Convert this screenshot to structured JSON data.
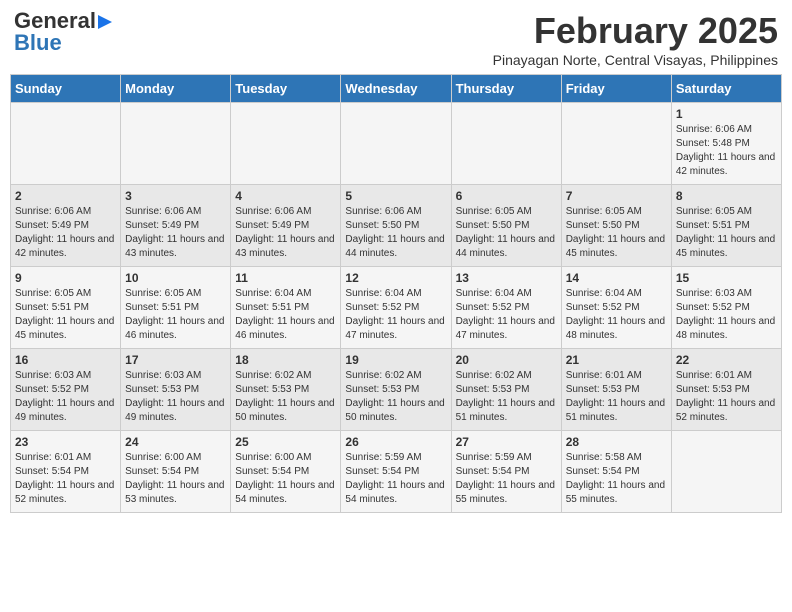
{
  "header": {
    "logo_line1": "General",
    "logo_line2": "Blue",
    "month": "February 2025",
    "location": "Pinayagan Norte, Central Visayas, Philippines"
  },
  "days_of_week": [
    "Sunday",
    "Monday",
    "Tuesday",
    "Wednesday",
    "Thursday",
    "Friday",
    "Saturday"
  ],
  "weeks": [
    [
      {
        "day": "",
        "info": ""
      },
      {
        "day": "",
        "info": ""
      },
      {
        "day": "",
        "info": ""
      },
      {
        "day": "",
        "info": ""
      },
      {
        "day": "",
        "info": ""
      },
      {
        "day": "",
        "info": ""
      },
      {
        "day": "1",
        "info": "Sunrise: 6:06 AM\nSunset: 5:48 PM\nDaylight: 11 hours and 42 minutes."
      }
    ],
    [
      {
        "day": "2",
        "info": "Sunrise: 6:06 AM\nSunset: 5:49 PM\nDaylight: 11 hours and 42 minutes."
      },
      {
        "day": "3",
        "info": "Sunrise: 6:06 AM\nSunset: 5:49 PM\nDaylight: 11 hours and 43 minutes."
      },
      {
        "day": "4",
        "info": "Sunrise: 6:06 AM\nSunset: 5:49 PM\nDaylight: 11 hours and 43 minutes."
      },
      {
        "day": "5",
        "info": "Sunrise: 6:06 AM\nSunset: 5:50 PM\nDaylight: 11 hours and 44 minutes."
      },
      {
        "day": "6",
        "info": "Sunrise: 6:05 AM\nSunset: 5:50 PM\nDaylight: 11 hours and 44 minutes."
      },
      {
        "day": "7",
        "info": "Sunrise: 6:05 AM\nSunset: 5:50 PM\nDaylight: 11 hours and 45 minutes."
      },
      {
        "day": "8",
        "info": "Sunrise: 6:05 AM\nSunset: 5:51 PM\nDaylight: 11 hours and 45 minutes."
      }
    ],
    [
      {
        "day": "9",
        "info": "Sunrise: 6:05 AM\nSunset: 5:51 PM\nDaylight: 11 hours and 45 minutes."
      },
      {
        "day": "10",
        "info": "Sunrise: 6:05 AM\nSunset: 5:51 PM\nDaylight: 11 hours and 46 minutes."
      },
      {
        "day": "11",
        "info": "Sunrise: 6:04 AM\nSunset: 5:51 PM\nDaylight: 11 hours and 46 minutes."
      },
      {
        "day": "12",
        "info": "Sunrise: 6:04 AM\nSunset: 5:52 PM\nDaylight: 11 hours and 47 minutes."
      },
      {
        "day": "13",
        "info": "Sunrise: 6:04 AM\nSunset: 5:52 PM\nDaylight: 11 hours and 47 minutes."
      },
      {
        "day": "14",
        "info": "Sunrise: 6:04 AM\nSunset: 5:52 PM\nDaylight: 11 hours and 48 minutes."
      },
      {
        "day": "15",
        "info": "Sunrise: 6:03 AM\nSunset: 5:52 PM\nDaylight: 11 hours and 48 minutes."
      }
    ],
    [
      {
        "day": "16",
        "info": "Sunrise: 6:03 AM\nSunset: 5:52 PM\nDaylight: 11 hours and 49 minutes."
      },
      {
        "day": "17",
        "info": "Sunrise: 6:03 AM\nSunset: 5:53 PM\nDaylight: 11 hours and 49 minutes."
      },
      {
        "day": "18",
        "info": "Sunrise: 6:02 AM\nSunset: 5:53 PM\nDaylight: 11 hours and 50 minutes."
      },
      {
        "day": "19",
        "info": "Sunrise: 6:02 AM\nSunset: 5:53 PM\nDaylight: 11 hours and 50 minutes."
      },
      {
        "day": "20",
        "info": "Sunrise: 6:02 AM\nSunset: 5:53 PM\nDaylight: 11 hours and 51 minutes."
      },
      {
        "day": "21",
        "info": "Sunrise: 6:01 AM\nSunset: 5:53 PM\nDaylight: 11 hours and 51 minutes."
      },
      {
        "day": "22",
        "info": "Sunrise: 6:01 AM\nSunset: 5:53 PM\nDaylight: 11 hours and 52 minutes."
      }
    ],
    [
      {
        "day": "23",
        "info": "Sunrise: 6:01 AM\nSunset: 5:54 PM\nDaylight: 11 hours and 52 minutes."
      },
      {
        "day": "24",
        "info": "Sunrise: 6:00 AM\nSunset: 5:54 PM\nDaylight: 11 hours and 53 minutes."
      },
      {
        "day": "25",
        "info": "Sunrise: 6:00 AM\nSunset: 5:54 PM\nDaylight: 11 hours and 54 minutes."
      },
      {
        "day": "26",
        "info": "Sunrise: 5:59 AM\nSunset: 5:54 PM\nDaylight: 11 hours and 54 minutes."
      },
      {
        "day": "27",
        "info": "Sunrise: 5:59 AM\nSunset: 5:54 PM\nDaylight: 11 hours and 55 minutes."
      },
      {
        "day": "28",
        "info": "Sunrise: 5:58 AM\nSunset: 5:54 PM\nDaylight: 11 hours and 55 minutes."
      },
      {
        "day": "",
        "info": ""
      }
    ]
  ]
}
